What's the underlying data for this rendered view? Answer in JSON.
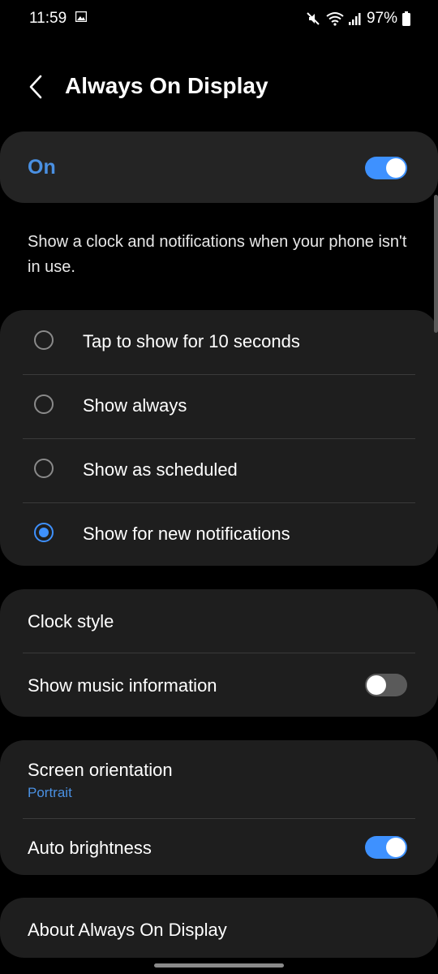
{
  "status_bar": {
    "time": "11:59",
    "battery": "97%",
    "icons": [
      "gallery-icon",
      "mute-icon",
      "wifi-icon",
      "signal-icon",
      "battery-icon"
    ]
  },
  "header": {
    "title": "Always On Display",
    "back_icon": "chevron-left-icon"
  },
  "master_switch": {
    "label": "On",
    "enabled": true
  },
  "description": "Show a clock and notifications when your phone isn't in use.",
  "display_modes": {
    "options": [
      {
        "label": "Tap to show for 10 seconds",
        "selected": false
      },
      {
        "label": "Show always",
        "selected": false
      },
      {
        "label": "Show as scheduled",
        "selected": false
      },
      {
        "label": "Show for new notifications",
        "selected": true
      }
    ]
  },
  "clock_section": {
    "clock_style": "Clock style",
    "music_info": {
      "label": "Show music information",
      "enabled": false
    }
  },
  "screen_section": {
    "orientation": {
      "label": "Screen orientation",
      "value": "Portrait"
    },
    "auto_brightness": {
      "label": "Auto brightness",
      "enabled": true
    }
  },
  "about": "About Always On Display",
  "colors": {
    "accent": "#3e91ff",
    "accent_text": "#4a90e2",
    "card": "#1e1e1e",
    "background": "#000000"
  }
}
